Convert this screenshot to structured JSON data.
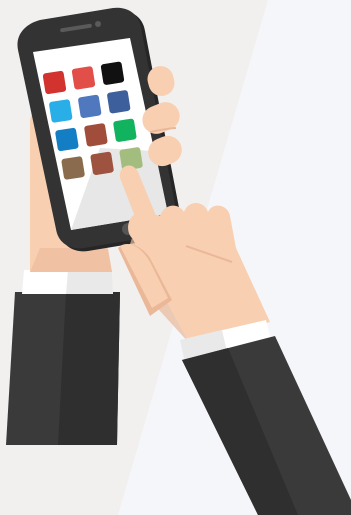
{
  "illustration": {
    "subject": "hands-holding-smartphone",
    "colors": {
      "background_left": "#f2f0ef",
      "background_right": "#f5f6fa",
      "skin": "#f8cfb1",
      "skin_shade": "#eab898",
      "sleeve": "#3a3a3a",
      "sleeve_shade": "#2e2e2e",
      "cuff": "#ffffff",
      "cuff_shade": "#e8e8e8",
      "phone_body": "#2f2f2f",
      "screen": "#ffffff",
      "screen_shadow": "#e6e6e6"
    },
    "app_tiles": [
      {
        "row": 1,
        "col": 1,
        "color": "#d2332f"
      },
      {
        "row": 1,
        "col": 2,
        "color": "#e24f49"
      },
      {
        "row": 1,
        "col": 3,
        "color": "#111111"
      },
      {
        "row": 2,
        "col": 1,
        "color": "#29aee8"
      },
      {
        "row": 2,
        "col": 2,
        "color": "#4f78bf"
      },
      {
        "row": 2,
        "col": 3,
        "color": "#3d5f9b"
      },
      {
        "row": 3,
        "col": 1,
        "color": "#137ec4"
      },
      {
        "row": 3,
        "col": 2,
        "color": "#a04d3b"
      },
      {
        "row": 3,
        "col": 3,
        "color": "#11b35e"
      },
      {
        "row": 4,
        "col": 1,
        "color": "#8a6b4d"
      },
      {
        "row": 4,
        "col": 2,
        "color": "#9e5340"
      },
      {
        "row": 4,
        "col": 3,
        "color": "#a3bd7e"
      }
    ]
  }
}
